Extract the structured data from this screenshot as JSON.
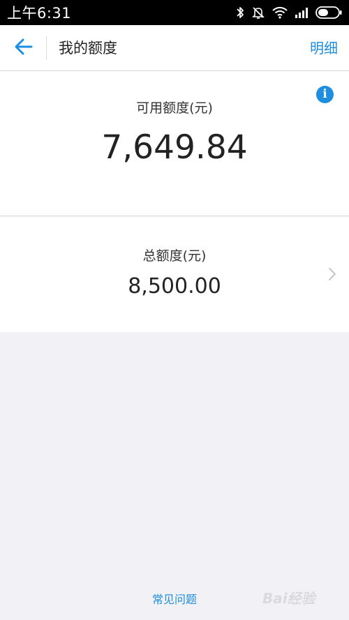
{
  "status_bar": {
    "time": "上午6:31",
    "icons": [
      "bluetooth-icon",
      "bell-muted-icon",
      "wifi-icon",
      "signal-icon",
      "battery-icon"
    ]
  },
  "navbar": {
    "back_icon": "arrow-left-icon",
    "title": "我的额度",
    "detail_label": "明细"
  },
  "available_credit": {
    "label": "可用额度(元)",
    "value": "7,649.84",
    "info_icon": "info-icon"
  },
  "total_credit": {
    "label": "总额度(元)",
    "value": "8,500.00",
    "chevron_icon": "chevron-right-icon"
  },
  "footer": {
    "faq_label": "常见问题"
  },
  "watermark": {
    "text": "Bai经验"
  },
  "colors": {
    "accent": "#1e8ee0",
    "background": "#f2f2f6",
    "card": "#ffffff",
    "status_bar": "#000000"
  }
}
